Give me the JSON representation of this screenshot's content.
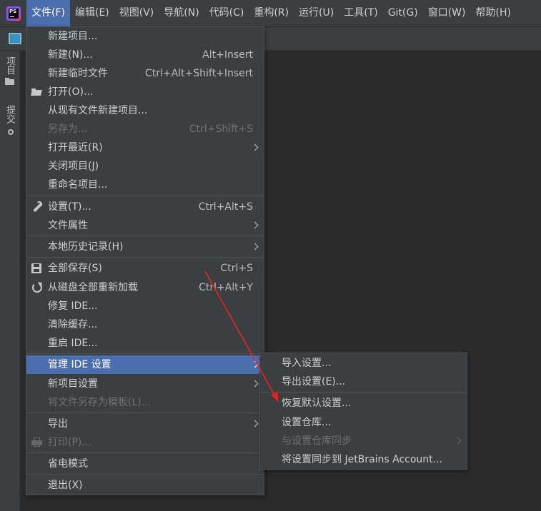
{
  "app": {
    "logo_icon": "phpstorm-logo-icon",
    "logo_text": "PS"
  },
  "menubar": [
    {
      "label": "文件(F)",
      "active": true
    },
    {
      "label": "编辑(E)"
    },
    {
      "label": "视图(V)"
    },
    {
      "label": "导航(N)"
    },
    {
      "label": "代码(C)"
    },
    {
      "label": "重构(R)"
    },
    {
      "label": "运行(U)"
    },
    {
      "label": "工具(T)"
    },
    {
      "label": "Git(G)"
    },
    {
      "label": "窗口(W)"
    },
    {
      "label": "帮助(H)"
    }
  ],
  "left_strip": {
    "project_label": "项目",
    "commit_label": "提交"
  },
  "file_menu": {
    "items": [
      {
        "label": "新建项目..."
      },
      {
        "label": "新建(N)...",
        "shortcut": "Alt+Insert"
      },
      {
        "label": "新建临时文件",
        "shortcut": "Ctrl+Alt+Shift+Insert"
      },
      {
        "label": "打开(O)...",
        "icon": "folder-open-icon"
      },
      {
        "label": "从现有文件新建项目..."
      },
      {
        "label": "另存为...",
        "shortcut": "Ctrl+Shift+S",
        "disabled": true
      },
      {
        "label": "打开最近(R)",
        "submenu": true
      },
      {
        "label": "关闭项目(J)"
      },
      {
        "label": "重命名项目..."
      },
      {
        "label": "设置(T)...",
        "shortcut": "Ctrl+Alt+S",
        "icon": "wrench-icon"
      },
      {
        "label": "文件属性",
        "submenu": true
      },
      {
        "label": "本地历史记录(H)",
        "submenu": true
      },
      {
        "label": "全部保存(S)",
        "shortcut": "Ctrl+S",
        "icon": "save-icon"
      },
      {
        "label": "从磁盘全部重新加载",
        "shortcut": "Ctrl+Alt+Y",
        "icon": "reload-icon"
      },
      {
        "label": "修复 IDE..."
      },
      {
        "label": "清除缓存..."
      },
      {
        "label": "重启 IDE..."
      },
      {
        "label": "管理 IDE 设置",
        "submenu": true,
        "selected": true
      },
      {
        "label": "新项目设置",
        "submenu": true
      },
      {
        "label": "将文件另存为模板(L)...",
        "disabled": true
      },
      {
        "label": "导出",
        "submenu": true
      },
      {
        "label": "打印(P)...",
        "icon": "print-icon",
        "disabled": true
      },
      {
        "label": "省电模式"
      },
      {
        "label": "退出(X)"
      }
    ]
  },
  "sub_menu": {
    "items": [
      {
        "label": "导入设置..."
      },
      {
        "label": "导出设置(E)..."
      },
      {
        "label": "恢复默认设置..."
      },
      {
        "label": "设置仓库..."
      },
      {
        "label": "与设置仓库同步",
        "submenu": true,
        "disabled": true
      },
      {
        "label": "将设置同步到 JetBrains Account..."
      }
    ]
  },
  "colors": {
    "accent": "#4b6eaf",
    "background": "#2b2b2b",
    "panel": "#3c3f41",
    "annotation_arrow": "#e8231e"
  }
}
